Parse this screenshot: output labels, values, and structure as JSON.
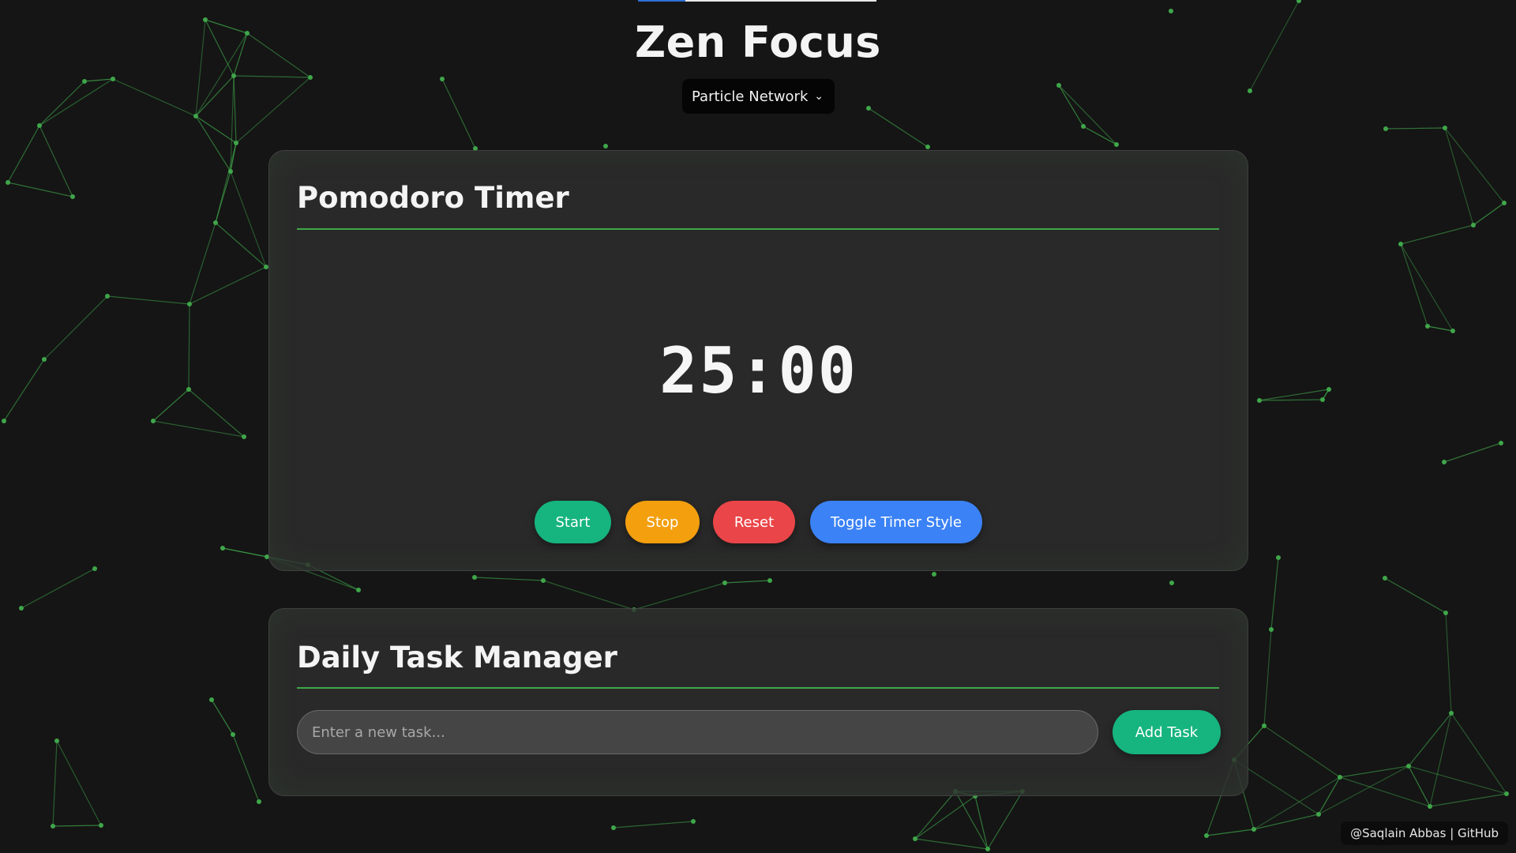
{
  "header": {
    "title": "Zen Focus",
    "progress": 0.2
  },
  "background_selector": {
    "selected": "Particle Network",
    "chevron_icon": "chevron-down-icon"
  },
  "timer_card": {
    "title": "Pomodoro Timer",
    "time": "25:00",
    "buttons": {
      "start": "Start",
      "stop": "Stop",
      "reset": "Reset",
      "toggle": "Toggle Timer Style"
    }
  },
  "task_card": {
    "title": "Daily Task Manager",
    "input_placeholder": "Enter a new task...",
    "input_value": "",
    "add_label": "Add Task"
  },
  "footer": {
    "credit": "@Saqlain Abbas | GitHub"
  },
  "colors": {
    "background": "#151515",
    "network": "#3fa64a",
    "start": "#16b47f",
    "stop": "#f39f0e",
    "reset": "#ea4548",
    "toggle": "#3b82f6"
  }
}
